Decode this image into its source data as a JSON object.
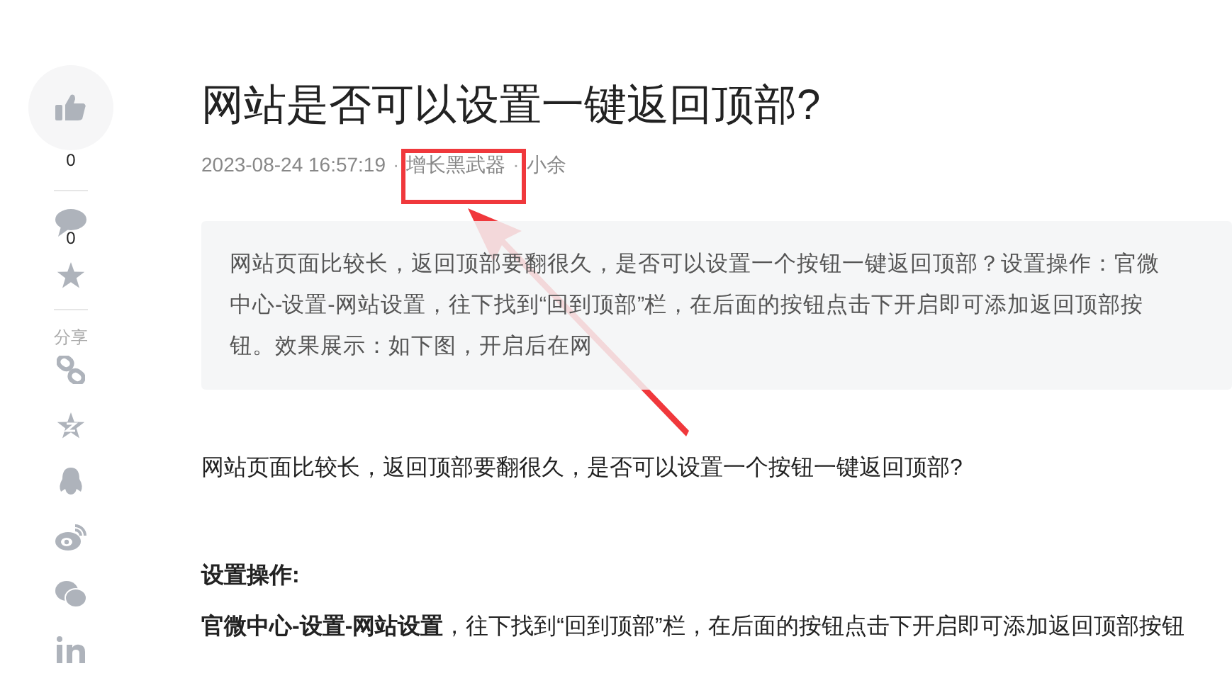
{
  "sidebar": {
    "like_count": "0",
    "comment_count": "0",
    "share_label": "分享"
  },
  "article": {
    "title": "网站是否可以设置一键返回顶部?",
    "date": "2023-08-24 16:57:19",
    "category": "增长黑武器",
    "separator": "·",
    "author": "小余",
    "summary": "网站页面比较长，返回顶部要翻很久，是否可以设置一个按钮一键返回顶部？设置操作：官微中心-设置-网站设置，往下找到“回到顶部”栏，在后面的按钮点击下开启即可添加返回顶部按钮。效果展示：如下图，开启后在网",
    "paragraphs": [
      {
        "kind": "text",
        "text": "网站页面比较长，返回顶部要翻很久，是否可以设置一个按钮一键返回顶部?"
      },
      {
        "kind": "heading",
        "text": "设置操作:"
      },
      {
        "kind": "text",
        "text": "**官微中心-设置-网站设置**，往下找到“回到顶部”栏，在后面的按钮点击下开启即可添加返回顶部按钮"
      }
    ]
  }
}
